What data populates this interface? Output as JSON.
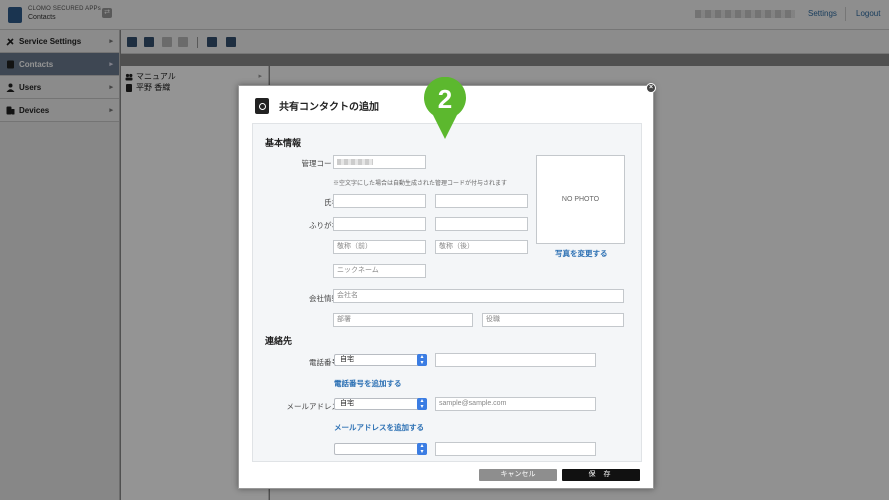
{
  "app": {
    "name": "CLOMO SECURED APPs",
    "subtitle": "Contacts"
  },
  "header": {
    "settings_label": "Settings",
    "logout_label": "Logout"
  },
  "sidebar": {
    "items": [
      {
        "label": "Service Settings",
        "icon": "tools-icon"
      },
      {
        "label": "Contacts",
        "icon": "contacts-icon",
        "active": true
      },
      {
        "label": "Users",
        "icon": "user-icon"
      },
      {
        "label": "Devices",
        "icon": "devices-icon"
      }
    ]
  },
  "contact_list": {
    "items": [
      {
        "label": "マニュアル",
        "icon": "group-icon"
      },
      {
        "label": "平野 香織",
        "icon": "contact-card-icon"
      }
    ]
  },
  "modal": {
    "title": "共有コンタクトの追加",
    "step_number": "2",
    "sections": {
      "basic": "基本情報",
      "contact": "連絡先"
    },
    "fields": {
      "management_code_label": "管理コード",
      "management_code_hint": "※空文字にした場合は自動生成された管理コードが付与されます",
      "name_label": "氏名",
      "furigana_label": "ふりがな",
      "honorific_first_placeholder": "敬称（前）",
      "honorific_last_placeholder": "敬称（後）",
      "nickname_placeholder": "ニックネーム",
      "company_label": "会社情報",
      "company_placeholder": "会社名",
      "department_placeholder": "部署",
      "title_placeholder": "役職",
      "phone_label": "電話番号",
      "phone_type": "自宅",
      "add_phone_link": "電話番号を追加する",
      "email_label": "メールアドレス",
      "email_type": "自宅",
      "email_placeholder": "sample@sample.com",
      "add_email_link": "メールアドレスを追加する"
    },
    "photo": {
      "placeholder": "NO PHOTO",
      "change_link": "写真を変更する"
    },
    "buttons": {
      "cancel": "キャンセル",
      "save": "保 存"
    }
  },
  "colors": {
    "accent": "#2a6fb3",
    "callout": "#5cb82e",
    "select_arrow": "#3b7de3"
  }
}
